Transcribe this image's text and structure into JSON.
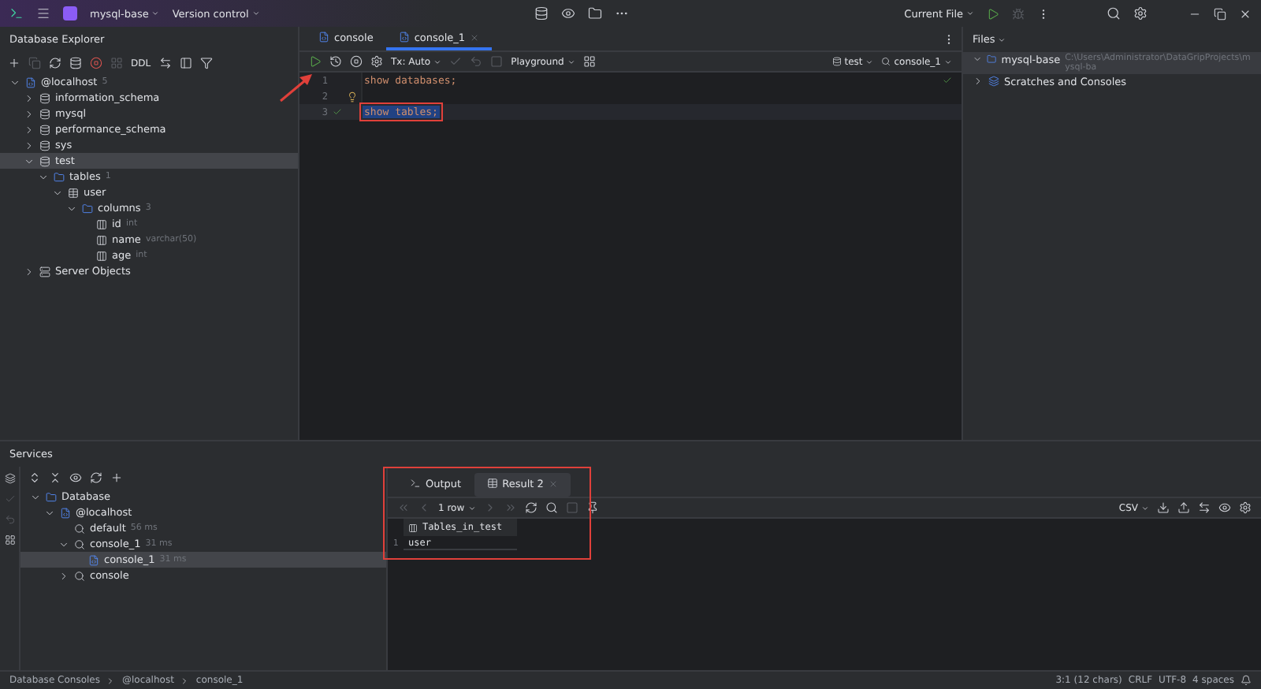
{
  "title_bar": {
    "project": "mysql-base",
    "vcs": "Version control",
    "run_config": "Current File"
  },
  "explorer": {
    "title": "Database Explorer",
    "ddl": "DDL",
    "tree": [
      {
        "label": "@localhost",
        "note": "5",
        "kind": "host",
        "expanded": true,
        "selected": false,
        "children": [
          {
            "label": "information_schema",
            "kind": "schema",
            "expanded": false,
            "selected": false
          },
          {
            "label": "mysql",
            "kind": "schema",
            "expanded": false,
            "selected": false
          },
          {
            "label": "performance_schema",
            "kind": "schema",
            "expanded": false,
            "selected": false
          },
          {
            "label": "sys",
            "kind": "schema",
            "expanded": false,
            "selected": false
          },
          {
            "label": "test",
            "kind": "schema",
            "expanded": true,
            "selected": true,
            "children": [
              {
                "label": "tables",
                "note": "1",
                "kind": "folder",
                "expanded": true,
                "selected": false,
                "children": [
                  {
                    "label": "user",
                    "kind": "table",
                    "expanded": true,
                    "selected": false,
                    "children": [
                      {
                        "label": "columns",
                        "note": "3",
                        "kind": "folder",
                        "expanded": true,
                        "selected": false,
                        "children": [
                          {
                            "label": "id",
                            "note": "int",
                            "kind": "column",
                            "selected": false
                          },
                          {
                            "label": "name",
                            "note": "varchar(50)",
                            "kind": "column",
                            "selected": false
                          },
                          {
                            "label": "age",
                            "note": "int",
                            "kind": "column",
                            "selected": false
                          }
                        ]
                      }
                    ]
                  }
                ]
              }
            ]
          },
          {
            "label": "Server Objects",
            "kind": "server",
            "expanded": false,
            "selected": false
          }
        ]
      }
    ]
  },
  "editor": {
    "tabs": [
      {
        "label": "console",
        "selected": false
      },
      {
        "label": "console_1",
        "selected": true
      }
    ],
    "tx": "Tx: Auto",
    "mode": "Playground",
    "schema": "test",
    "session": "console_1",
    "lines": [
      {
        "number": "1",
        "text": "show databases;",
        "hint": false,
        "ok": false,
        "selected": false
      },
      {
        "number": "2",
        "hint": true,
        "ok": false,
        "selected": false
      },
      {
        "number": "3",
        "text": "show tables;",
        "hint": false,
        "ok": true,
        "selected": true
      }
    ]
  },
  "files": {
    "title": "Files",
    "tree": [
      {
        "label": "mysql-base",
        "path": "C:\\Users\\Administrator\\DataGripProjects\\mysql-ba",
        "kind": "folder",
        "expanded": true
      },
      {
        "label": "Scratches and Consoles",
        "kind": "scratch",
        "expanded": false
      }
    ]
  },
  "services": {
    "title": "Services",
    "tree": [
      {
        "label": "Database",
        "kind": "folder",
        "expanded": true,
        "selected": false,
        "children": [
          {
            "label": "@localhost",
            "kind": "host",
            "expanded": true,
            "selected": false,
            "children": [
              {
                "label": "default",
                "note": "56 ms",
                "kind": "session",
                "selected": false
              },
              {
                "label": "console_1",
                "note": "31 ms",
                "kind": "session",
                "expanded": true,
                "selected": false,
                "children": [
                  {
                    "label": "console_1",
                    "note": "31 ms",
                    "kind": "host",
                    "selected": true
                  }
                ]
              },
              {
                "label": "console",
                "kind": "session",
                "expanded": false,
                "selected": false
              }
            ]
          }
        ]
      }
    ],
    "result_tabs": [
      {
        "label": "Output",
        "selected": false
      },
      {
        "label": "Result 2",
        "selected": true
      }
    ],
    "rows_label": "1 row",
    "export_format": "CSV",
    "grid": {
      "columns": [
        "Tables_in_test"
      ],
      "rows": [
        {
          "number": "1",
          "cells": [
            "user"
          ]
        }
      ]
    }
  },
  "status_bar": {
    "breadcrumbs": [
      "Database Consoles",
      "@localhost",
      "console_1"
    ],
    "position": "3:1 (12 chars)",
    "line_ending": "CRLF",
    "encoding": "UTF-8",
    "indent": "4 spaces"
  }
}
